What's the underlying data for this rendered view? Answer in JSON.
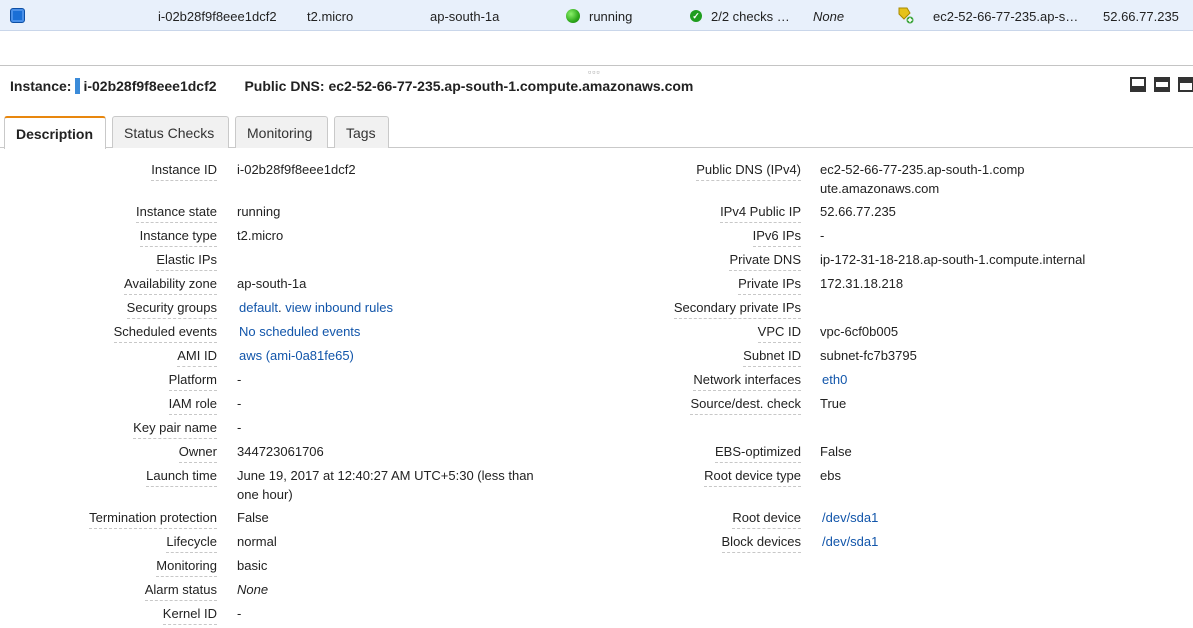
{
  "top_row": {
    "instance_id": "i-02b28f9f8eee1dcf2",
    "instance_type": "t2.micro",
    "availability_zone": "ap-south-1a",
    "state": "running",
    "status_checks": "2/2 checks …",
    "alarm_status": "None",
    "public_dns": "ec2-52-66-77-235.ap-s…",
    "public_ip": "52.66.77.235"
  },
  "header": {
    "instance_label": "Instance:",
    "instance_id": "i-02b28f9f8eee1dcf2",
    "dns_label": "Public DNS:",
    "dns_value": "ec2-52-66-77-235.ap-south-1.compute.amazonaws.com"
  },
  "tabs": [
    {
      "label": "Description"
    },
    {
      "label": "Status Checks"
    },
    {
      "label": "Monitoring"
    },
    {
      "label": "Tags"
    }
  ],
  "left": {
    "instance_id": {
      "label": "Instance ID",
      "value": "i-02b28f9f8eee1dcf2"
    },
    "instance_state": {
      "label": "Instance state",
      "value": "running"
    },
    "instance_type": {
      "label": "Instance type",
      "value": "t2.micro"
    },
    "elastic_ips": {
      "label": "Elastic IPs",
      "value": ""
    },
    "availability_zone": {
      "label": "Availability zone",
      "value": "ap-south-1a"
    },
    "security_groups": {
      "label": "Security groups",
      "value": "default",
      "sep": ".",
      "link2": "view inbound rules"
    },
    "scheduled_events": {
      "label": "Scheduled events",
      "value": "No scheduled events"
    },
    "ami_id": {
      "label": "AMI ID",
      "value": "aws (ami-0a81fe65)"
    },
    "platform": {
      "label": "Platform",
      "value": "-"
    },
    "iam_role": {
      "label": "IAM role",
      "value": "-"
    },
    "key_pair_name": {
      "label": "Key pair name",
      "value": "-"
    },
    "owner": {
      "label": "Owner",
      "value": "344723061706"
    },
    "launch_time": {
      "label": "Launch time",
      "value": "June 19, 2017 at 12:40:27 AM UTC+5:30 (less than one hour)"
    },
    "termination_protection": {
      "label": "Termination protection",
      "value": "False"
    },
    "lifecycle": {
      "label": "Lifecycle",
      "value": "normal"
    },
    "monitoring": {
      "label": "Monitoring",
      "value": "basic"
    },
    "alarm_status": {
      "label": "Alarm status",
      "value": "None"
    },
    "kernel_id": {
      "label": "Kernel ID",
      "value": "-"
    }
  },
  "right": {
    "public_dns": {
      "label": "Public DNS (IPv4)",
      "value": "ec2-52-66-77-235.ap-south-1.compute.amazonaws.com"
    },
    "ipv4_public_ip": {
      "label": "IPv4 Public IP",
      "value": "52.66.77.235"
    },
    "ipv6_ips": {
      "label": "IPv6 IPs",
      "value": "-"
    },
    "private_dns": {
      "label": "Private DNS",
      "value": "ip-172-31-18-218.ap-south-1.compute.internal"
    },
    "private_ips": {
      "label": "Private IPs",
      "value": "172.31.18.218"
    },
    "secondary_private_ips": {
      "label": "Secondary private IPs",
      "value": ""
    },
    "vpc_id": {
      "label": "VPC ID",
      "value": "vpc-6cf0b005"
    },
    "subnet_id": {
      "label": "Subnet ID",
      "value": "subnet-fc7b3795"
    },
    "network_interfaces": {
      "label": "Network interfaces",
      "value": "eth0"
    },
    "source_dest_check": {
      "label": "Source/dest. check",
      "value": "True"
    },
    "ebs_optimized": {
      "label": "EBS-optimized",
      "value": "False"
    },
    "root_device_type": {
      "label": "Root device type",
      "value": "ebs"
    },
    "root_device": {
      "label": "Root device",
      "value": "/dev/sda1"
    },
    "block_devices": {
      "label": "Block devices",
      "value": "/dev/sda1"
    }
  },
  "colors": {
    "link": "#1155aa",
    "tab_accent": "#e8870e",
    "selected_row": "#e8f0fb",
    "running": "#2ea81b"
  },
  "icons": [
    "checkbox-icon",
    "running-status-icon",
    "check-passed-icon",
    "key-pair-icon",
    "layout-bottom-icon",
    "layout-split-icon",
    "layout-full-icon"
  ]
}
